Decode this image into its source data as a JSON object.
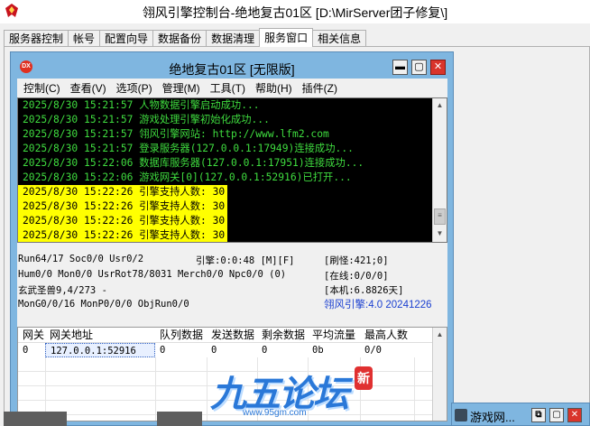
{
  "window": {
    "title": "翎风引擎控制台-绝地复古01区 [D:\\MirServer团子修复\\]"
  },
  "tabs": [
    {
      "label": "服务器控制",
      "active": false
    },
    {
      "label": "帐号",
      "active": false
    },
    {
      "label": "配置向导",
      "active": false
    },
    {
      "label": "数据备份",
      "active": false
    },
    {
      "label": "数据清理",
      "active": false
    },
    {
      "label": "服务窗口",
      "active": true
    },
    {
      "label": "相关信息",
      "active": false
    }
  ],
  "inner_window": {
    "icon_text": "DX",
    "title": "绝地复古01区 [无限版]",
    "buttons": {
      "minimize": "▬",
      "maximize": "▢",
      "close": "✕"
    }
  },
  "menu": [
    "控制(C)",
    "查看(V)",
    "选项(P)",
    "管理(M)",
    "工具(T)",
    "帮助(H)",
    "插件(Z)"
  ],
  "log": [
    {
      "text": "2025/8/30 15:21:57 人物数据引擎启动成功...",
      "highlight": false
    },
    {
      "text": "2025/8/30 15:21:57 游戏处理引擎初始化成功...",
      "highlight": false
    },
    {
      "text": "2025/8/30 15:21:57 翎风引擎网站: http://www.lfm2.com",
      "highlight": false
    },
    {
      "text": "2025/8/30 15:21:57 登录服务器(127.0.0.1:17949)连接成功...",
      "highlight": false
    },
    {
      "text": "2025/8/30 15:22:06 数据库服务器(127.0.0.1:17951)连接成功...",
      "highlight": false
    },
    {
      "text": "2025/8/30 15:22:06 游戏网关[0](127.0.0.1:52916)已打开...",
      "highlight": false
    },
    {
      "text": "2025/8/30 15:22:26 引擎支持人数: 30",
      "highlight": true
    },
    {
      "text": "2025/8/30 15:22:26 引擎支持人数: 30",
      "highlight": true
    },
    {
      "text": "2025/8/30 15:22:26 引擎支持人数: 30",
      "highlight": true
    },
    {
      "text": "2025/8/30 15:22:26 引擎支持人数: 30",
      "highlight": true
    }
  ],
  "status": {
    "run": "Run64/17 Soc0/0 Usr0/2",
    "engine": "引擎:0:0:48 [M][F]",
    "refresh": "[刷怪:421;0]",
    "hum": "Hum0/0 Mon0/0 UsrRot78/8031 Merch0/0 Npc0/0 (0)",
    "online": "[在线:0/0/0]",
    "beast": "玄武圣兽9,4/273 -",
    "local": "[本机:6.8826天]",
    "mong": "MonG0/0/16 MonP0/0/0 ObjRun0/0",
    "version": "翎风引擎:4.0 20241226"
  },
  "gate_table": {
    "headers": [
      "网关",
      "网关地址",
      "队列数据",
      "发送数据",
      "剩余数据",
      "平均流量",
      "最高人数"
    ],
    "rows": [
      [
        "0",
        "127.0.0.1:52916",
        "0",
        "0",
        "0",
        "0b",
        "0/0"
      ]
    ]
  },
  "watermark": {
    "text": "九五论坛",
    "url": "www.95gm.com",
    "seal": "新"
  },
  "mini_window": {
    "label": "游戏网...",
    "buttons": {
      "restore": "⧉",
      "maximize": "▢",
      "close": "✕"
    }
  },
  "colors": {
    "log_text": "#3fdc3f",
    "log_highlight": "#ffff00",
    "mdi_frame": "#7fb6e0",
    "version_text": "#1a3fd0"
  }
}
